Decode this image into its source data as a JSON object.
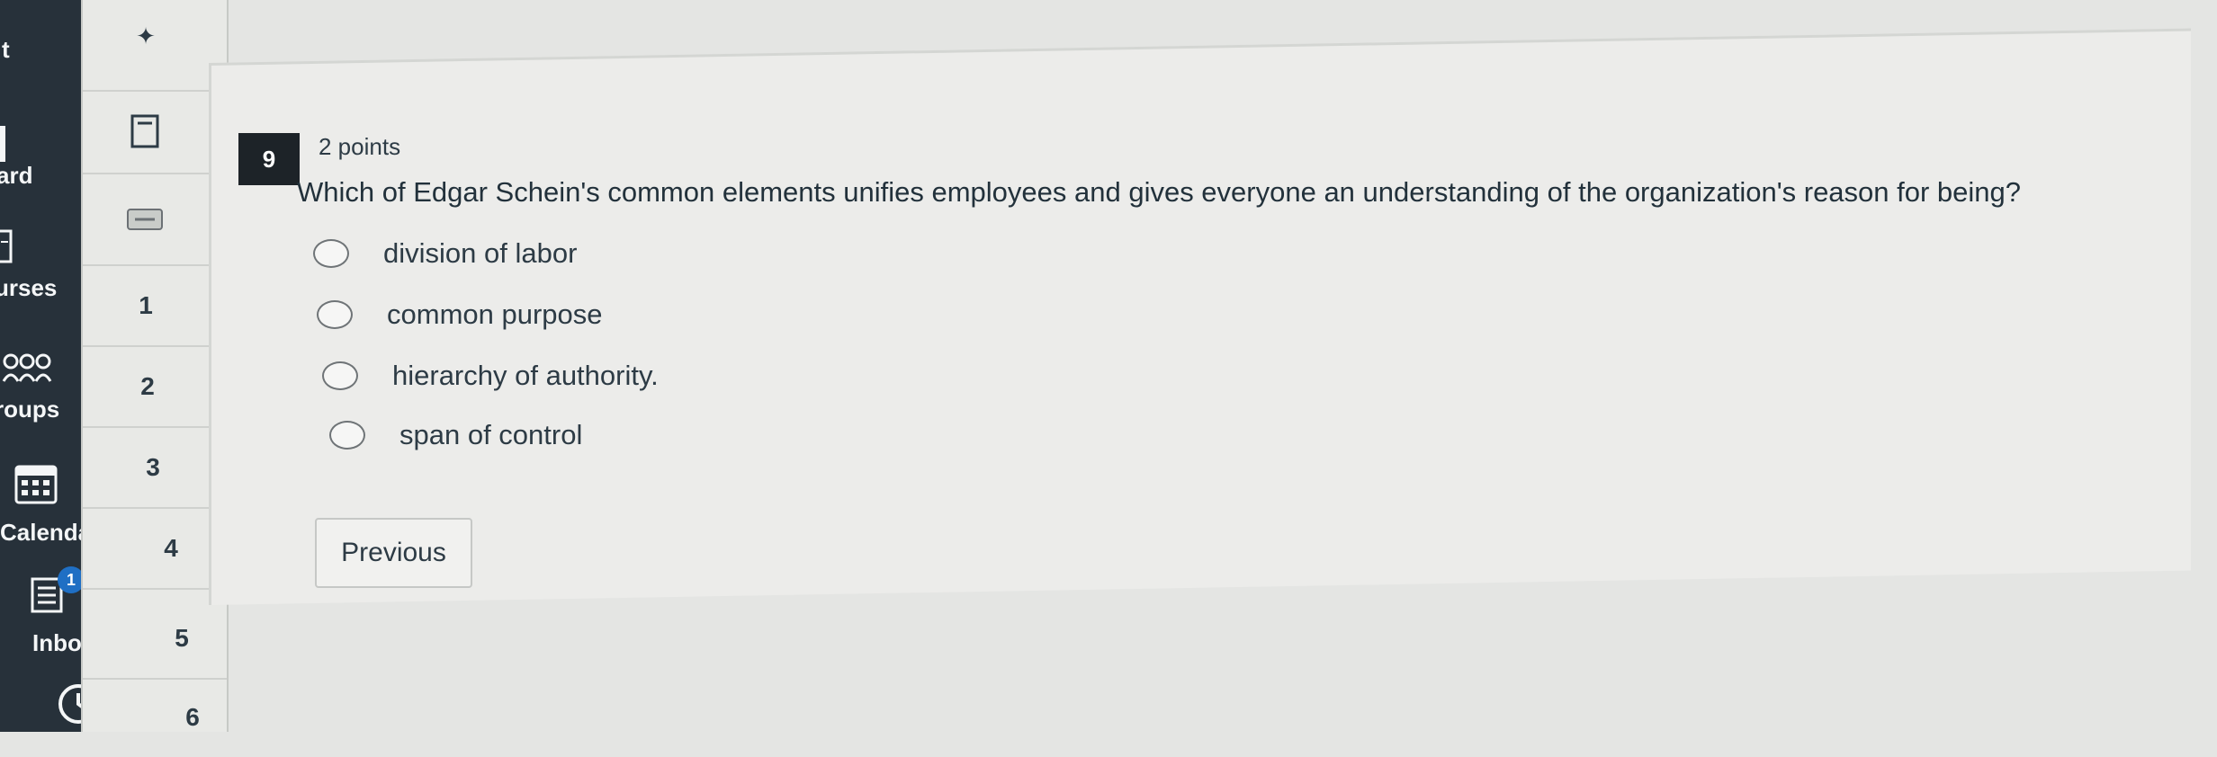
{
  "global_nav": {
    "items": [
      {
        "label": "ard",
        "icon": "dashboard-icon"
      },
      {
        "label": "urses",
        "icon": "courses-icon"
      },
      {
        "label": "roups",
        "icon": "groups-icon"
      },
      {
        "label": "Calendar",
        "icon": "calendar-icon"
      },
      {
        "label": "Inbox",
        "icon": "inbox-icon",
        "badge": "1"
      },
      {
        "label": "",
        "icon": "history-icon"
      }
    ],
    "top_label": "t"
  },
  "question_nav": {
    "pin_icon": "pin-icon",
    "numbers": [
      "1",
      "2",
      "3",
      "4",
      "5",
      "6"
    ]
  },
  "question": {
    "number": "9",
    "points": "2 points",
    "text": "Which of Edgar Schein's common elements unifies employees and gives everyone an understanding of the organization's reason for being?",
    "options": [
      "division of labor",
      "common purpose",
      "hierarchy of authority.",
      "span of control"
    ]
  },
  "buttons": {
    "previous": "Previous"
  },
  "colors": {
    "global_nav_bg": "#27313a",
    "question_badge_bg": "#1d2328",
    "page_bg": "#e4e5e3"
  }
}
